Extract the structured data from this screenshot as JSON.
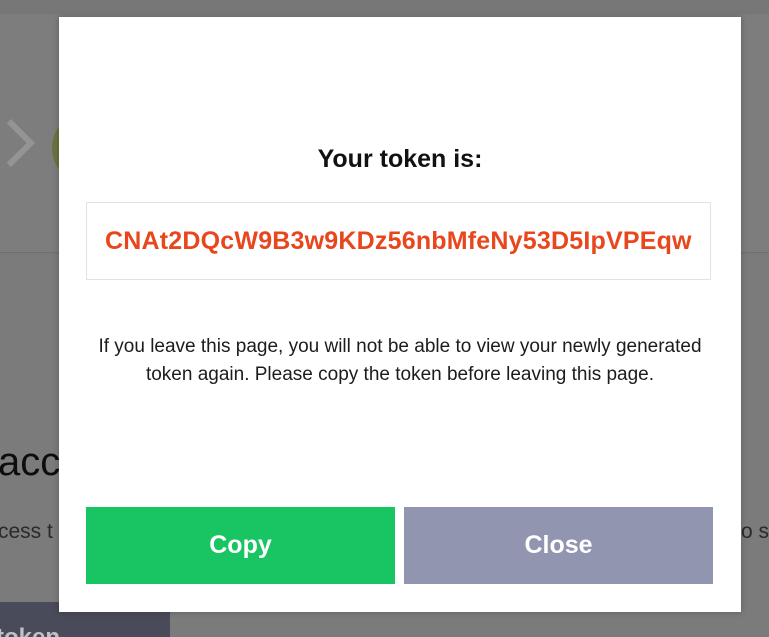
{
  "background": {
    "heading_fragment": "acc",
    "text_left_fragment": "cess t",
    "text_right_fragment": "o s",
    "button_fragment": "token"
  },
  "modal": {
    "title": "Your token is:",
    "token": "CNAt2DQcW9B3w9KDz56nbMfeNy53D5IpVPEqw",
    "message": "If you leave this page, you will not be able to view your newly generated token again. Please copy the token before leaving this page.",
    "copy_label": "Copy",
    "close_label": "Close"
  },
  "colors": {
    "token_text": "#e8471d",
    "copy_button": "#19c463",
    "close_button": "#9195b0",
    "overlay": "#808080"
  }
}
